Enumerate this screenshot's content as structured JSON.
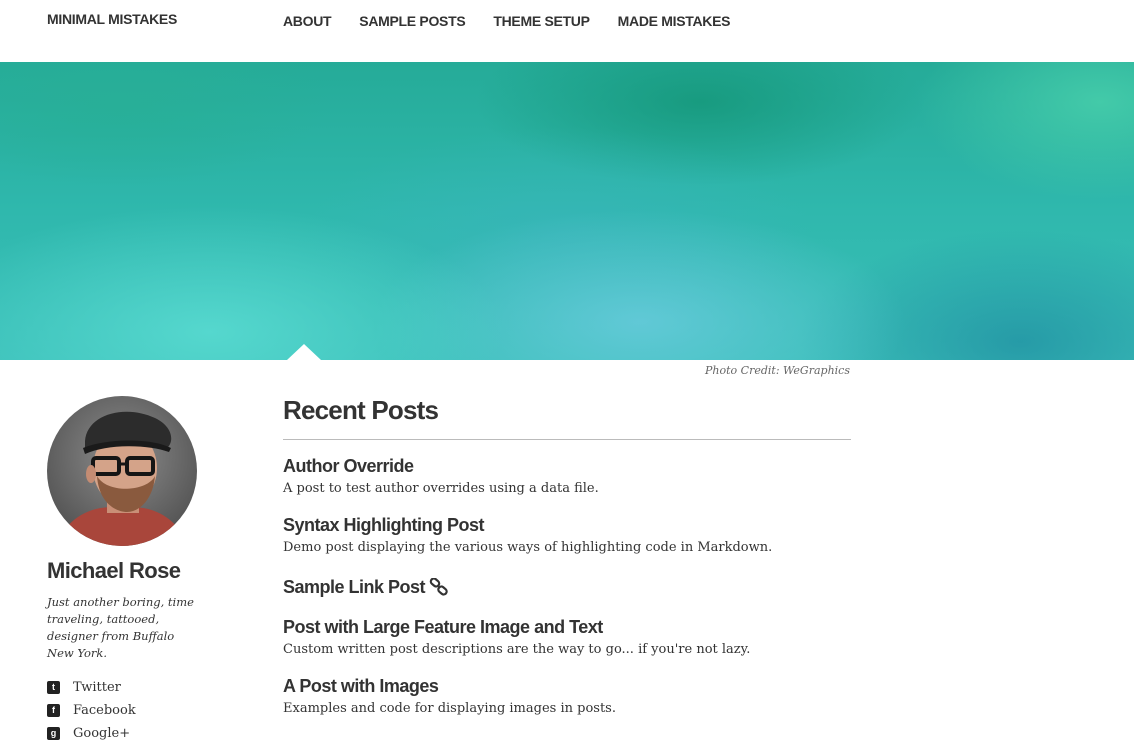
{
  "nav": {
    "site_title": "MINIMAL MISTAKES",
    "links": [
      "ABOUT",
      "SAMPLE POSTS",
      "THEME SETUP",
      "MADE MISTAKES"
    ]
  },
  "feature": {
    "credit_prefix": "Photo Credit: ",
    "credit_link": "WeGraphics"
  },
  "author": {
    "name": "Michael Rose",
    "bio": "Just another boring, time traveling, tattooed, designer from Buffalo New York.",
    "social": [
      {
        "icon": "twitter-icon",
        "label": "Twitter"
      },
      {
        "icon": "facebook-icon",
        "label": "Facebook"
      },
      {
        "icon": "google-plus-icon",
        "label": "Google+"
      }
    ]
  },
  "main": {
    "section_title": "Recent Posts",
    "posts": [
      {
        "title": "Author Override",
        "excerpt": "A post to test author overrides using a data file."
      },
      {
        "title": "Syntax Highlighting Post",
        "excerpt": "Demo post displaying the various ways of highlighting code in Markdown."
      },
      {
        "title": "Sample Link Post",
        "excerpt": "",
        "icon": "link-icon"
      },
      {
        "title": "Post with Large Feature Image and Text",
        "excerpt": "Custom written post descriptions are the way to go... if you're not lazy."
      },
      {
        "title": "A Post with Images",
        "excerpt": "Examples and code for displaying images in posts."
      }
    ]
  },
  "colors": {
    "banner_teal": "#2fb8ad",
    "text": "#333333"
  }
}
